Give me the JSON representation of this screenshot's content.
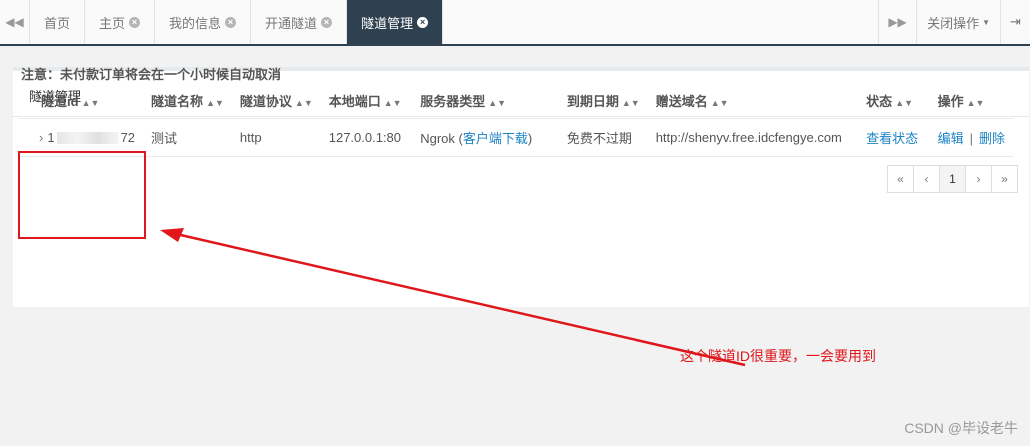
{
  "tabbar": {
    "tabs": [
      {
        "label": "首页",
        "closable": false
      },
      {
        "label": "主页",
        "closable": true
      },
      {
        "label": "我的信息",
        "closable": true
      },
      {
        "label": "开通隧道",
        "closable": true
      },
      {
        "label": "隧道管理",
        "closable": true,
        "active": true
      }
    ],
    "close_ops_label": "关闭操作",
    "nav_left_icon": "double-left-icon",
    "nav_right_icon": "double-right-icon",
    "exit_icon": "exit-icon"
  },
  "panel": {
    "title": "隧道管理",
    "notice": "注意：未付款订单将会在一个小时候自动取消"
  },
  "table": {
    "headers": [
      "隧道id",
      "隧道名称",
      "隧道协议",
      "本地端口",
      "服务器类型",
      "到期日期",
      "赠送域名",
      "状态",
      "操作"
    ],
    "rows": [
      {
        "id_prefix": "1",
        "id_suffix": "72",
        "name": "测试",
        "protocol": "http",
        "local_port": "127.0.0.1:80",
        "server_type": "Ngrok",
        "download_link": "客户端下载",
        "expire": "免费不过期",
        "domain": "http://shenyv.free.idcfengye.com",
        "status_link": "查看状态",
        "edit_link": "编辑",
        "delete_link": "删除"
      }
    ]
  },
  "pagination": {
    "first": "«",
    "prev": "‹",
    "current": "1",
    "next": "›",
    "last": "»"
  },
  "annotation": "这个隧道ID很重要，一会要用到",
  "watermark": "CSDN @毕设老牛",
  "colors": {
    "accent": "#2f4050",
    "link": "#1c84c6",
    "annotation": "#e0161b"
  }
}
